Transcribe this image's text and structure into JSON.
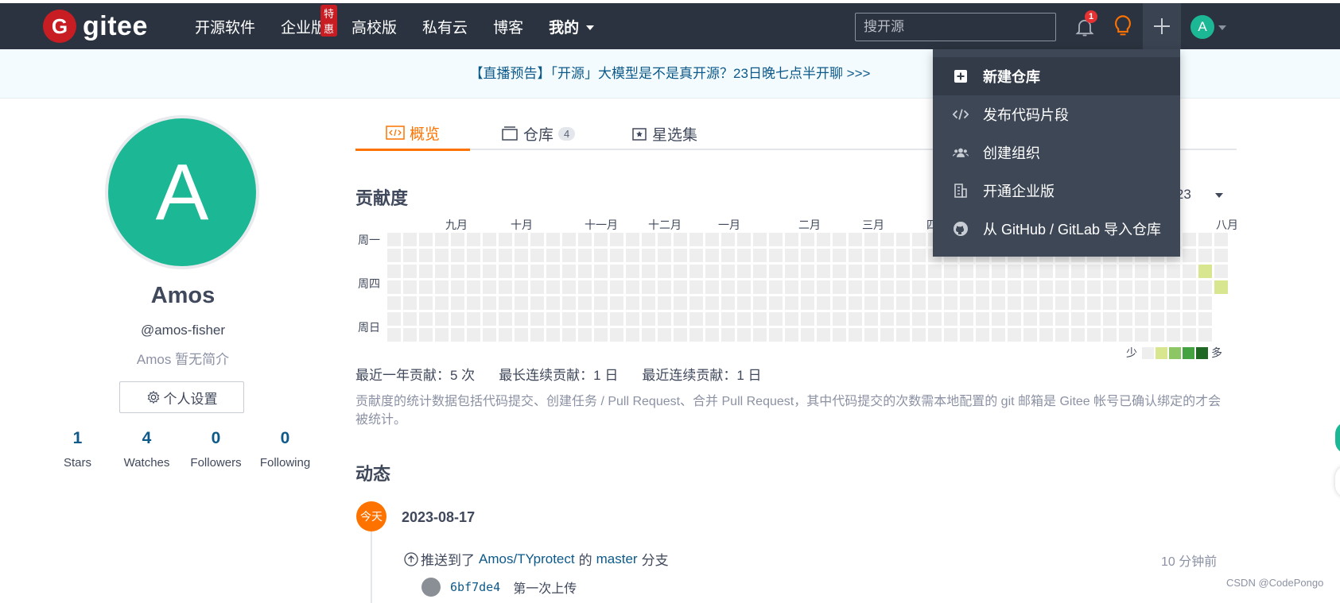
{
  "header": {
    "logo_text": "gitee",
    "nav": [
      {
        "label": "开源软件"
      },
      {
        "label": "企业版",
        "badge": "特惠"
      },
      {
        "label": "高校版"
      },
      {
        "label": "私有云"
      },
      {
        "label": "博客"
      },
      {
        "label": "我的"
      }
    ],
    "search_placeholder": "搜开源",
    "notification_count": "1",
    "user_initial": "A"
  },
  "announcement": "【直播预告】「开源」大模型是不是真开源？23日晚七点半开聊 >>>",
  "profile": {
    "initial": "A",
    "name": "Amos",
    "handle": "@amos-fisher",
    "bio": "Amos 暂无简介",
    "settings_label": "个人设置",
    "stats": [
      {
        "num": "1",
        "label": "Stars"
      },
      {
        "num": "4",
        "label": "Watches"
      },
      {
        "num": "0",
        "label": "Followers"
      },
      {
        "num": "0",
        "label": "Following"
      }
    ]
  },
  "tabs": [
    {
      "label": "概览",
      "active": true
    },
    {
      "label": "仓库",
      "count": "4"
    },
    {
      "label": "星选集"
    }
  ],
  "contribution": {
    "title": "贡献度",
    "year": "2023",
    "months": [
      "九月",
      "十月",
      "十一月",
      "十二月",
      "一月",
      "二月",
      "三月",
      "四",
      "八月"
    ],
    "days": [
      "周一",
      "周四",
      "周日"
    ],
    "legend_less": "少",
    "legend_more": "多",
    "legend_colors": [
      "#eeeeee",
      "#d7e68f",
      "#8cc665",
      "#44a340",
      "#1e6823"
    ],
    "total": "最近一年贡献：5 次",
    "longest": "最长连续贡献：1 日",
    "recent": "最近连续贡献：1 日",
    "note": "贡献度的统计数据包括代码提交、创建任务 / Pull Request、合并 Pull Request，其中代码提交的次数需本地配置的 git 邮箱是 Gitee 帐号已确认绑定的才会被统计。"
  },
  "activity": {
    "title": "动态",
    "today_label": "今天",
    "date": "2023-08-17",
    "push_prefix": "推送到了",
    "repo": "Amos/TYprotect",
    "push_mid": "的",
    "branch": "master",
    "push_suffix": "分支",
    "time_ago": "10 分钟前",
    "commit_hash": "6bf7de4",
    "commit_msg": "第一次上传"
  },
  "dropdown": {
    "items": [
      {
        "label": "新建仓库",
        "icon": "plus-square-icon"
      },
      {
        "label": "发布代码片段",
        "icon": "code-icon"
      },
      {
        "label": "创建组织",
        "icon": "group-icon"
      },
      {
        "label": "开通企业版",
        "icon": "building-icon"
      },
      {
        "label": "从 GitHub / GitLab 导入仓库",
        "icon": "github-icon"
      }
    ]
  },
  "watermark": "CSDN @CodePongo"
}
